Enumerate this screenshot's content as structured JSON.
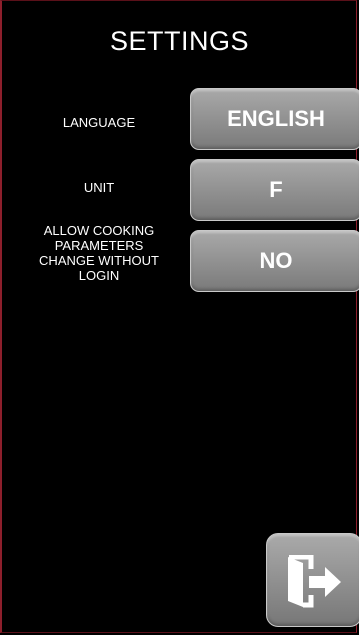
{
  "header": {
    "title": "SETTINGS"
  },
  "settings": [
    {
      "label": "LANGUAGE",
      "value": "ENGLISH"
    },
    {
      "label": "UNIT",
      "value": "F"
    },
    {
      "label_lines": [
        "ALLOW COOKING",
        "PARAMETERS",
        "CHANGE WITHOUT",
        "LOGIN"
      ],
      "value": "NO"
    }
  ],
  "footer": {
    "exit_icon": "exit-door-arrow-icon"
  },
  "colors": {
    "background": "#000000",
    "border": "#8e1f2c",
    "button": "#8f8f8f",
    "text": "#ffffff"
  }
}
